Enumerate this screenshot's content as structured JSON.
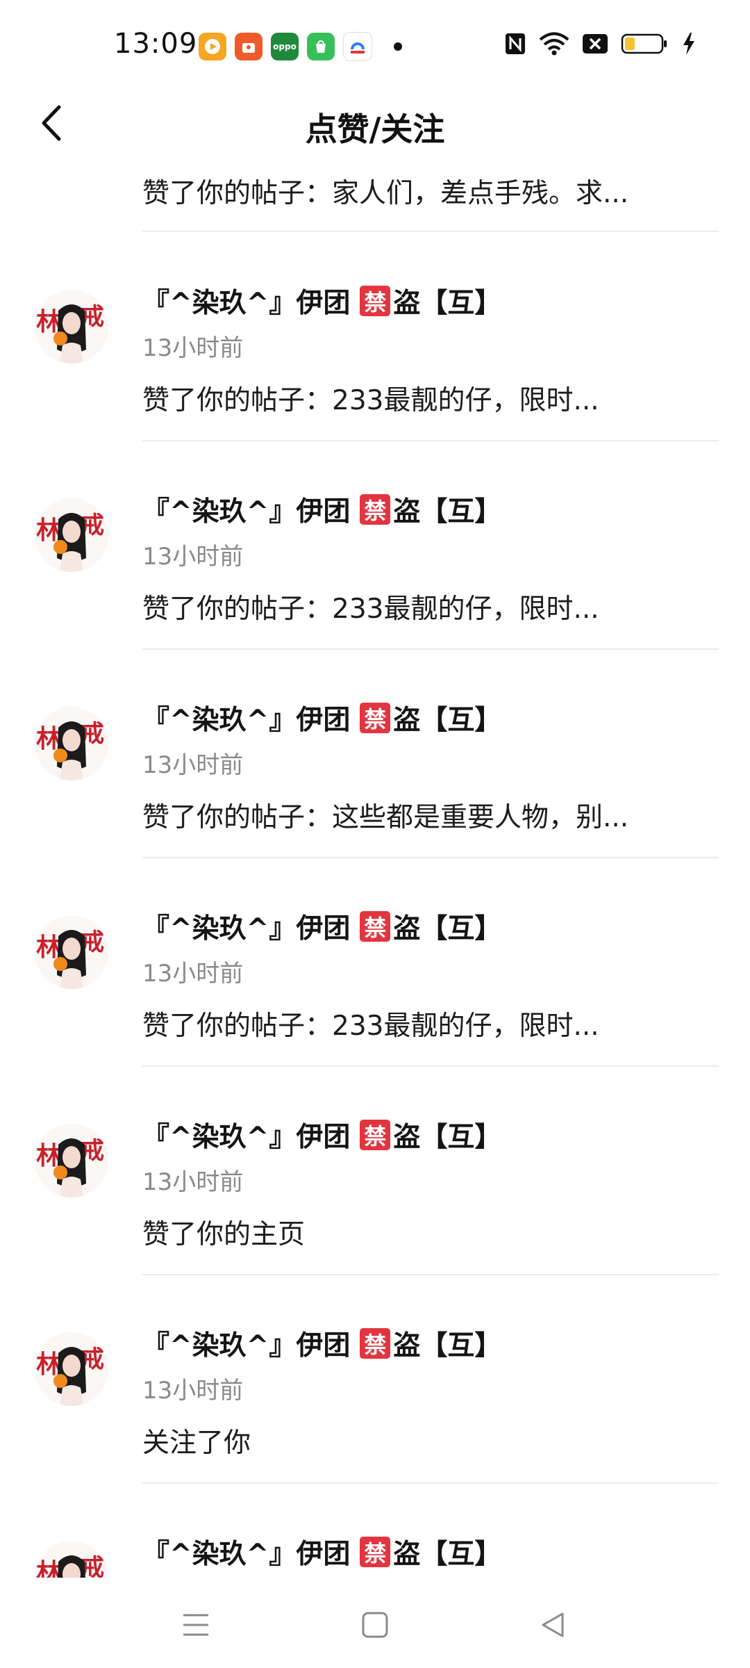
{
  "status_bar": {
    "time": "13:09",
    "apps": [
      {
        "icon": "video-app-icon",
        "color": "#f5a623"
      },
      {
        "icon": "shopping-app-icon",
        "color": "#ef5a2a"
      },
      {
        "icon": "oppo-app-icon",
        "color": "#1f8a3c",
        "label": "oppo"
      },
      {
        "icon": "store-app-icon",
        "color": "#37c05a"
      },
      {
        "icon": "browser-app-icon",
        "color": "#2f7df6"
      }
    ],
    "colors": {
      "battery_fill": "#f4c32f"
    }
  },
  "header": {
    "title": "点赞/关注",
    "back_icon": "chevron-left-icon"
  },
  "list": {
    "partial_item_text": "赞了你的帖子：家人们，差点手残。求...",
    "name_prefix": "『^染玖^』伊团",
    "ban_badge": "禁",
    "name_suffix": "盗【互】",
    "items": [
      {
        "time": "13小时前",
        "action": "赞了你的帖子：233最靓的仔，限时..."
      },
      {
        "time": "13小时前",
        "action": "赞了你的帖子：233最靓的仔，限时..."
      },
      {
        "time": "13小时前",
        "action": "赞了你的帖子：这些都是重要人物，别..."
      },
      {
        "time": "13小时前",
        "action": "赞了你的帖子：233最靓的仔，限时..."
      },
      {
        "time": "13小时前",
        "action": "赞了你的主页"
      },
      {
        "time": "13小时前",
        "action": "关注了你"
      },
      {
        "time": "",
        "action": ""
      }
    ]
  },
  "nav_bar": {
    "menu_icon": "menu-icon",
    "home_icon": "home-square-icon",
    "back_icon": "back-triangle-icon"
  },
  "colors": {
    "accent_red": "#e2353f",
    "divider": "#ececec",
    "muted_text": "#8a8a8a"
  }
}
